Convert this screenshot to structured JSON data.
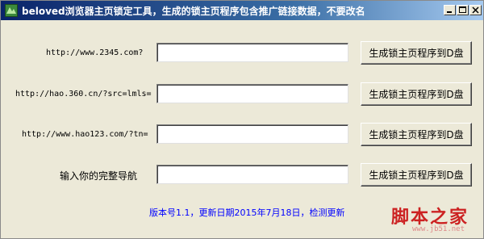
{
  "window": {
    "title": "beloved浏览器主页锁定工具，生成的锁主页程序包含推广链接数据，不要改名",
    "controls": {
      "minimize_icon": "minimize-icon",
      "maximize_icon": "maximize-icon",
      "close_icon": "close-icon"
    }
  },
  "rows": [
    {
      "label": "http://www.2345.com?",
      "value": "",
      "button": "生成锁主页程序到D盘"
    },
    {
      "label": "http://hao.360.cn/?src=lmls=",
      "value": "",
      "button": "生成锁主页程序到D盘"
    },
    {
      "label": "http://www.hao123.com/?tn=",
      "value": "",
      "button": "生成锁主页程序到D盘"
    },
    {
      "label": "输入你的完整导航",
      "value": "",
      "button": "生成锁主页程序到D盘"
    }
  ],
  "footer": {
    "text": "版本号1.1，更新日期2015年7月18日，检测更新"
  },
  "watermark": {
    "main": "脚本之家",
    "url": "www.jb51.net"
  },
  "colors": {
    "titlebar": "#0a246a",
    "window_bg": "#ece9d8",
    "link": "#0000ff",
    "watermark": "#cc2222"
  }
}
